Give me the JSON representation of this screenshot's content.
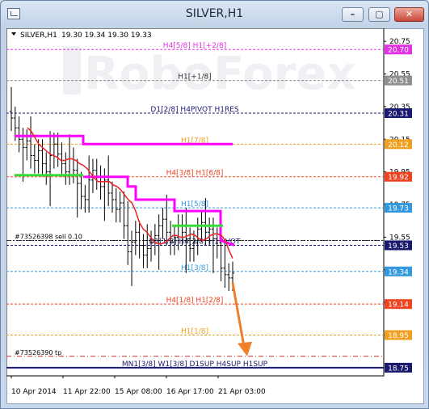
{
  "window": {
    "title": "SILVER,H1",
    "min_label": "–",
    "max_label": "▢",
    "close_label": "✕"
  },
  "chart_header": {
    "dropdown_icon": "triangle-down-icon",
    "symbol": "SILVER,H1",
    "ohlc": "19.30 19.34 19.30 19.33"
  },
  "watermark": "RoboForex",
  "chart_data": {
    "type": "candlestick",
    "ylim": [
      18.7,
      20.83
    ],
    "price_axis_ticks": [
      "20.75",
      "20.55",
      "20.35",
      "20.15",
      "19.95",
      "19.75",
      "19.55",
      "19.35",
      "19.15",
      "18.95"
    ],
    "x_tick_labels": [
      "10 Apr 2014",
      "11 Apr 22:00",
      "15 Apr 08:00",
      "16 Apr 17:00",
      "21 Apr 03:00"
    ],
    "levels": [
      {
        "label": "H4[5/8] H1[+2/8]",
        "price": 20.7,
        "price_label": "20.70",
        "color": "#e233e2",
        "style": "dashed",
        "label_color": "#e233e2"
      },
      {
        "label": "H1[+1/8]",
        "price": 20.51,
        "price_label": "20.51",
        "color": "#909090",
        "style": "dashed",
        "label_color": "#333333"
      },
      {
        "label": "D1[2/8] H4PIVOT H1RES",
        "price": 20.31,
        "price_label": "20.31",
        "color": "#1a1a6e",
        "style": "dashed",
        "label_color": "#1a1a6e"
      },
      {
        "label": "H1[7/8]",
        "price": 20.12,
        "price_label": "20.12",
        "color": "#f0a020",
        "style": "dashed",
        "label_color": "#f0a020"
      },
      {
        "label": "H4[3/8] H1[6/8]",
        "price": 19.92,
        "price_label": "19.92",
        "color": "#ee4422",
        "style": "dashed",
        "label_color": "#ee4422"
      },
      {
        "label": "H1[5/8]",
        "price": 19.73,
        "price_label": "19.73",
        "color": "#3399dd",
        "style": "dashed",
        "label_color": "#3399dd"
      },
      {
        "label": "D1[1/8] H4[2/8] H1PIVOT",
        "price": 19.5,
        "price_label": "19.53",
        "color": "#1a1a6e",
        "style": "dashed",
        "label_color": "#1a1a6e"
      },
      {
        "label": "H1[3/8]",
        "price": 19.34,
        "price_label": "19.34",
        "color": "#3399dd",
        "style": "dashed",
        "label_color": "#3399dd"
      },
      {
        "label": "H4[1/8] H1[2/8]",
        "price": 19.14,
        "price_label": "19.14",
        "color": "#ee4422",
        "style": "dashed",
        "label_color": "#ee4422"
      },
      {
        "label": "H1[1/8]",
        "price": 18.95,
        "price_label": "18.95",
        "color": "#f0a020",
        "style": "dashed",
        "label_color": "#f0a020"
      },
      {
        "label": "MN1[3/8] W1[3/8] D1SUP H4SUP H1SUP",
        "price": 18.75,
        "price_label": "18.75",
        "color": "#1a1a6e",
        "style": "solid",
        "label_color": "#1a1a6e"
      }
    ],
    "order_lines": [
      {
        "label": "#73526398 sell 0.10",
        "price": 19.53,
        "color": "#444444"
      },
      {
        "label": "#73526390 tp",
        "price": 18.82,
        "color": "#c03030"
      }
    ],
    "current_price": {
      "value": 19.53,
      "color": "#1a1a2a"
    },
    "closes": [
      20.28,
      20.22,
      20.15,
      20.1,
      20.14,
      20.05,
      20.02,
      20.08,
      20.0,
      19.95,
      20.05,
      20.12,
      20.06,
      20.0,
      19.95,
      20.03,
      19.96,
      19.88,
      19.8,
      19.78,
      19.9,
      19.96,
      19.92,
      19.86,
      19.9,
      19.82,
      19.78,
      19.72,
      19.76,
      19.62,
      19.46,
      19.52,
      19.58,
      19.5,
      19.44,
      19.48,
      19.52,
      19.56,
      19.62,
      19.66,
      19.58,
      19.52,
      19.55,
      19.62,
      19.58,
      19.54,
      19.48,
      19.52,
      19.6,
      19.64,
      19.58,
      19.6,
      19.54,
      19.5,
      19.36,
      19.32,
      19.3,
      19.33
    ],
    "red_ma": [
      20.22,
      20.2,
      20.16,
      20.12,
      20.1,
      20.08,
      20.06,
      20.05,
      20.04,
      20.02,
      20.02,
      20.03,
      20.03,
      20.02,
      20.0,
      19.99,
      19.97,
      19.94,
      19.91,
      19.89,
      19.89,
      19.89,
      19.89,
      19.87,
      19.86,
      19.84,
      19.81,
      19.78,
      19.76,
      19.71,
      19.64,
      19.6,
      19.58,
      19.55,
      19.52,
      19.51,
      19.51,
      19.52,
      19.54,
      19.56,
      19.56,
      19.55,
      19.55,
      19.56,
      19.57,
      19.56,
      19.54,
      19.53,
      19.54,
      19.56,
      19.57,
      19.57,
      19.56,
      19.53,
      19.47,
      19.42
    ],
    "steps": [
      {
        "color": "#ff00ff",
        "points": [
          [
            10,
            20.17
          ],
          [
            95,
            20.17
          ],
          [
            95,
            20.12
          ],
          [
            280,
            20.12
          ]
        ]
      },
      {
        "color": "#ff00ff",
        "points": [
          [
            95,
            19.92
          ],
          [
            150,
            19.92
          ],
          [
            150,
            19.86
          ],
          [
            160,
            19.86
          ],
          [
            160,
            19.78
          ],
          [
            208,
            19.78
          ],
          [
            208,
            19.71
          ],
          [
            265,
            19.71
          ],
          [
            265,
            19.53
          ],
          [
            282,
            19.5
          ]
        ]
      },
      {
        "color": "#33dd33",
        "points": [
          [
            10,
            19.93
          ],
          [
            95,
            19.93
          ]
        ]
      },
      {
        "color": "#33dd33",
        "points": [
          [
            205,
            19.62
          ],
          [
            268,
            19.62
          ]
        ]
      }
    ],
    "forecast_arrow": {
      "color": "#f07f2a",
      "from_price": 19.27,
      "to_price": 18.82
    }
  }
}
